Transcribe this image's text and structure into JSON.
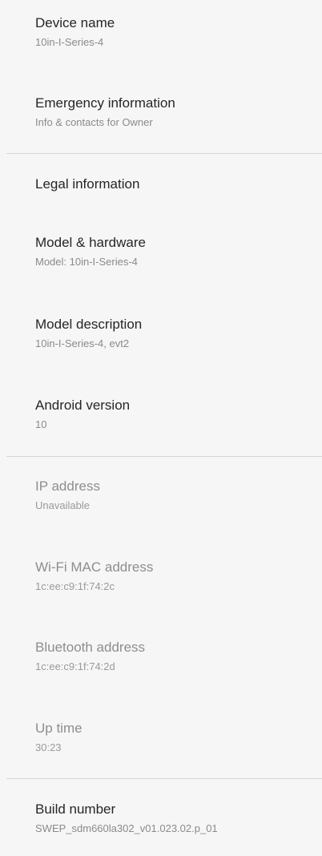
{
  "settings": {
    "device_name": {
      "title": "Device name",
      "summary": "10in-I-Series-4"
    },
    "emergency": {
      "title": "Emergency information",
      "summary": "Info & contacts for Owner"
    },
    "legal": {
      "title": "Legal information"
    },
    "model_hardware": {
      "title": "Model & hardware",
      "summary": "Model: 10in-I-Series-4"
    },
    "model_description": {
      "title": "Model description",
      "summary": "10in-I-Series-4, evt2"
    },
    "android_version": {
      "title": "Android version",
      "summary": "10"
    },
    "ip_address": {
      "title": "IP address",
      "summary": "Unavailable"
    },
    "wifi_mac": {
      "title": "Wi-Fi MAC address",
      "summary": "1c:ee:c9:1f:74:2c"
    },
    "bluetooth": {
      "title": "Bluetooth address",
      "summary": "1c:ee:c9:1f:74:2d"
    },
    "up_time": {
      "title": "Up time",
      "summary": "30:23"
    },
    "build_number": {
      "title": "Build number",
      "summary": "SWEP_sdm660la302_v01.023.02.p_01"
    }
  }
}
